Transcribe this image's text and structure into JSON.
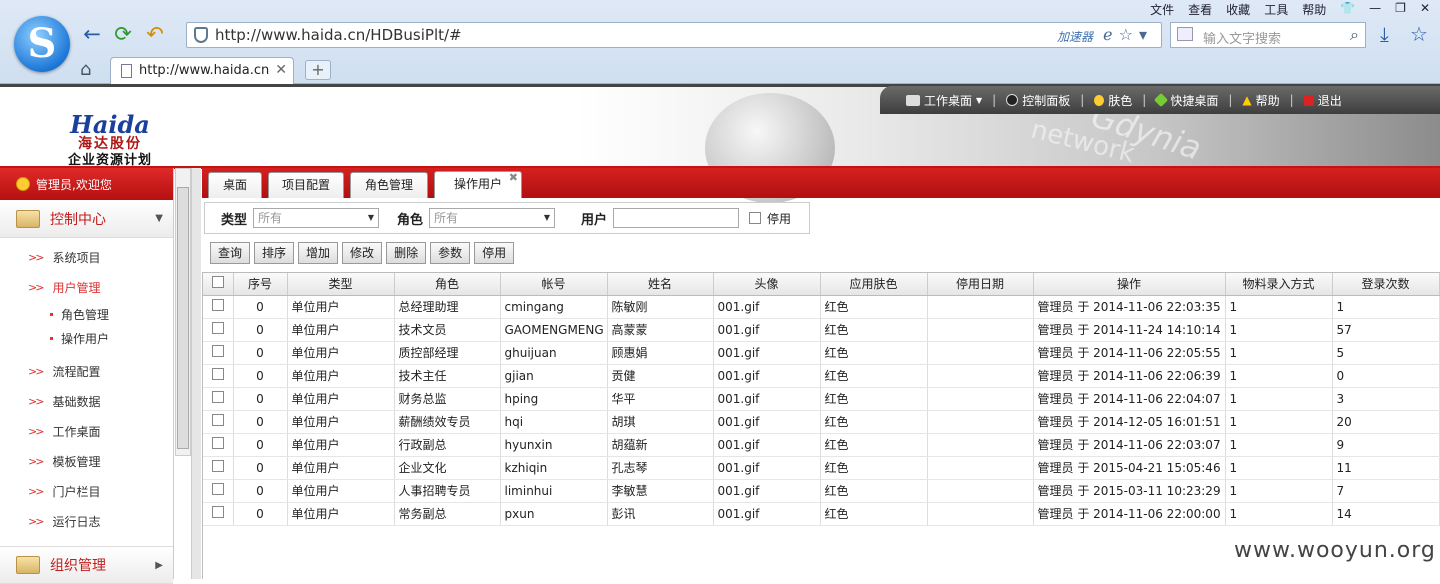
{
  "browser": {
    "menu": [
      "文件",
      "查看",
      "收藏",
      "工具",
      "帮助"
    ],
    "url": "http://www.haida.cn/HDBusiPlt/#",
    "accelerator": "加速器",
    "search_placeholder": "输入文字搜索",
    "tab_title": "http://www.haida.cn/HDBusiPlt/#",
    "new_tab": "+"
  },
  "app": {
    "brand_en": "Haida",
    "brand_cn": "海达股份",
    "brand_sub": "企业资源计划",
    "art_text1": "Gdynia",
    "art_text2": "network",
    "menu": {
      "workspace": "工作桌面",
      "control_panel": "控制面板",
      "skin": "肤色",
      "quick_desktop": "快捷桌面",
      "help": "帮助",
      "logout": "退出"
    }
  },
  "sidebar": {
    "welcome": "管理员,欢迎您",
    "group1": "控制中心",
    "items": [
      {
        "label": "系统项目"
      },
      {
        "label": "用户管理"
      },
      {
        "label": "流程配置"
      },
      {
        "label": "基础数据"
      },
      {
        "label": "工作桌面"
      },
      {
        "label": "模板管理"
      },
      {
        "label": "门户栏目"
      },
      {
        "label": "运行日志"
      }
    ],
    "subitems": [
      "角色管理",
      "操作用户"
    ],
    "group2": "组织管理"
  },
  "tabs": [
    "桌面",
    "项目配置",
    "角色管理",
    "操作用户"
  ],
  "filter": {
    "type_label": "类型",
    "type_value": "所有",
    "role_label": "角色",
    "role_value": "所有",
    "user_label": "用户",
    "disabled_label": "停用"
  },
  "toolbar": [
    "查询",
    "排序",
    "增加",
    "修改",
    "删除",
    "参数",
    "停用"
  ],
  "table": {
    "headers": [
      "序号",
      "类型",
      "角色",
      "帐号",
      "姓名",
      "头像",
      "应用肤色",
      "停用日期",
      "操作",
      "物料录入方式",
      "登录次数"
    ],
    "rows": [
      [
        "0",
        "单位用户",
        "总经理助理",
        "cmingang",
        "陈敏刚",
        "001.gif",
        "红色",
        "",
        "管理员 于 2014-11-06 22:03:35",
        "1",
        "1"
      ],
      [
        "0",
        "单位用户",
        "技术文员",
        "GAOMENGMENG",
        "高蒙蒙",
        "001.gif",
        "红色",
        "",
        "管理员 于 2014-11-24 14:10:14",
        "1",
        "57"
      ],
      [
        "0",
        "单位用户",
        "质控部经理",
        "ghuijuan",
        "顾惠娟",
        "001.gif",
        "红色",
        "",
        "管理员 于 2014-11-06 22:05:55",
        "1",
        "5"
      ],
      [
        "0",
        "单位用户",
        "技术主任",
        "gjian",
        "贡健",
        "001.gif",
        "红色",
        "",
        "管理员 于 2014-11-06 22:06:39",
        "1",
        "0"
      ],
      [
        "0",
        "单位用户",
        "财务总监",
        "hping",
        "华平",
        "001.gif",
        "红色",
        "",
        "管理员 于 2014-11-06 22:04:07",
        "1",
        "3"
      ],
      [
        "0",
        "单位用户",
        "薪酬绩效专员",
        "hqi",
        "胡琪",
        "001.gif",
        "红色",
        "",
        "管理员 于 2014-12-05 16:01:51",
        "1",
        "20"
      ],
      [
        "0",
        "单位用户",
        "行政副总",
        "hyunxin",
        "胡蕴新",
        "001.gif",
        "红色",
        "",
        "管理员 于 2014-11-06 22:03:07",
        "1",
        "9"
      ],
      [
        "0",
        "单位用户",
        "企业文化",
        "kzhiqin",
        "孔志琴",
        "001.gif",
        "红色",
        "",
        "管理员 于 2015-04-21 15:05:46",
        "1",
        "11"
      ],
      [
        "0",
        "单位用户",
        "人事招聘专员",
        "liminhui",
        "李敏慧",
        "001.gif",
        "红色",
        "",
        "管理员 于 2015-03-11 10:23:29",
        "1",
        "7"
      ],
      [
        "0",
        "单位用户",
        "常务副总",
        "pxun",
        "彭讯",
        "001.gif",
        "红色",
        "",
        "管理员 于 2014-11-06 22:00:00",
        "1",
        "14"
      ]
    ]
  },
  "watermark": "www.wooyun.org"
}
